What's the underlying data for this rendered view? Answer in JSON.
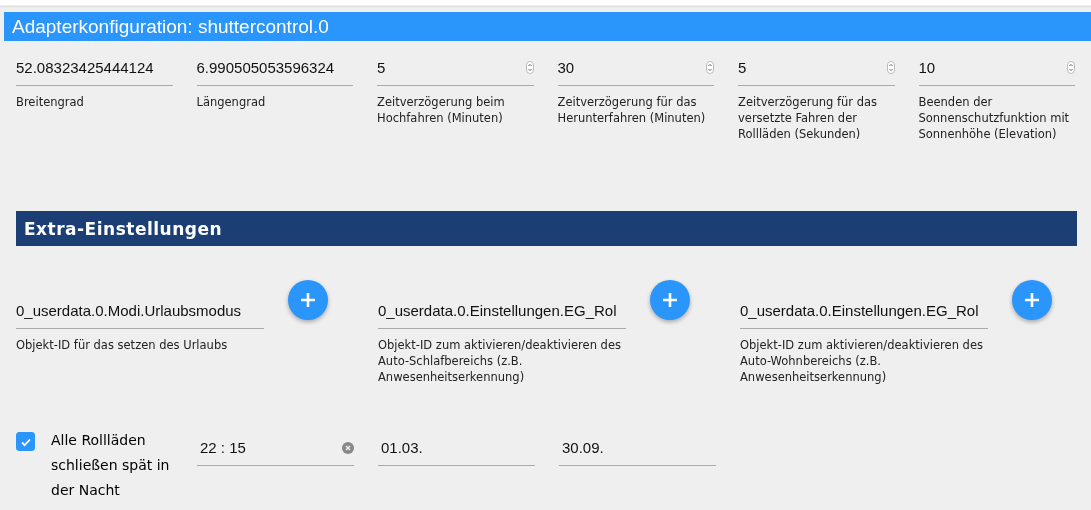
{
  "header": {
    "title": "Adapterkonfiguration: shuttercontrol.0"
  },
  "settings": [
    {
      "kind": "text",
      "value": "52.08323425444124",
      "label": "Breitengrad"
    },
    {
      "kind": "text",
      "value": "6.990505053596324",
      "label": "Längengrad"
    },
    {
      "kind": "number",
      "value": "5",
      "label": "Zeitverzögerung beim Hochfahren (Minuten)"
    },
    {
      "kind": "number",
      "value": "30",
      "label": "Zeitverzögerung für das Herunterfahren (Minuten)"
    },
    {
      "kind": "number",
      "value": "5",
      "label": "Zeitverzögerung für das versetzte Fahren der Rollläden (Sekunden)"
    },
    {
      "kind": "number",
      "value": "10",
      "label": "Beenden der Sonnenschutzfunktion mit Sonnenhöhe (Elevation)"
    }
  ],
  "extra": {
    "title": "Extra-Einstellungen",
    "object_ids": [
      {
        "value": "0_userdata.0.Modi.Urlaubsmodus",
        "label": "Objekt-ID für das setzen des Urlaubs"
      },
      {
        "value": "0_userdata.0.Einstellungen.EG_Rol",
        "label": "Objekt-ID zum aktivieren/deaktivieren des Auto-Schlafbereichs (z.B. Anwesenheitserkennung)"
      },
      {
        "value": "0_userdata.0.Einstellungen.EG_Rol",
        "label": "Objekt-ID zum aktivieren/deaktivieren des Auto-Wohnbereichs (z.B. Anwesenheitserkennung)"
      }
    ],
    "late_close": {
      "label": "Alle Rollläden schließen spät in der Nacht",
      "checked": true,
      "fields": [
        {
          "kind": "time",
          "value": "22 : 15"
        },
        {
          "kind": "text",
          "value": "01.03."
        },
        {
          "kind": "text",
          "value": "30.09."
        }
      ]
    }
  }
}
